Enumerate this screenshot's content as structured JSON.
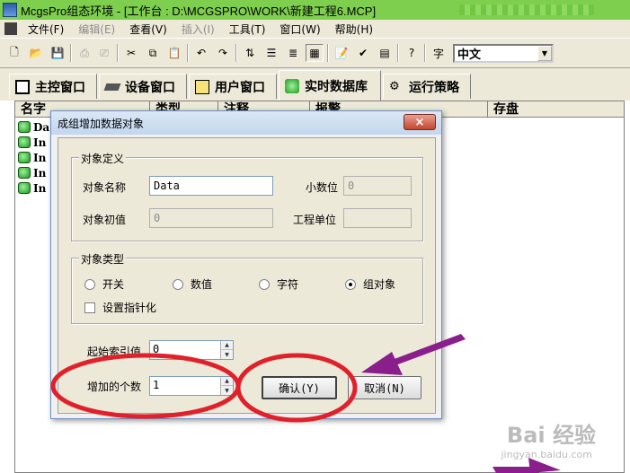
{
  "window": {
    "title": "McgsPro组态环境 - [工作台 : D:\\MCGSPRO\\WORK\\新建工程6.MCP]"
  },
  "menu": [
    {
      "label": "文件(F)",
      "enabled": true
    },
    {
      "label": "编辑(E)",
      "enabled": false
    },
    {
      "label": "查看(V)",
      "enabled": true
    },
    {
      "label": "插入(I)",
      "enabled": false
    },
    {
      "label": "工具(T)",
      "enabled": true
    },
    {
      "label": "窗口(W)",
      "enabled": true
    },
    {
      "label": "帮助(H)",
      "enabled": true
    }
  ],
  "toolbar": {
    "language": "中文"
  },
  "tabs": [
    {
      "label": "主控窗口",
      "icon": "main-window-icon"
    },
    {
      "label": "设备窗口",
      "icon": "device-window-icon"
    },
    {
      "label": "用户窗口",
      "icon": "user-window-icon"
    },
    {
      "label": "实时数据库",
      "icon": "database-icon",
      "active": true
    },
    {
      "label": "运行策略",
      "icon": "strategy-icon"
    }
  ],
  "list": {
    "columns": [
      "名字",
      "类型",
      "注释",
      "报警",
      "存盘"
    ],
    "rows": [
      "Da",
      "In",
      "In",
      "In",
      "In"
    ]
  },
  "dialog": {
    "title": "成组增加数据对象",
    "close_label": "×",
    "object_def": {
      "group_label": "对象定义",
      "name_label": "对象名称",
      "name_value": "Data",
      "decimal_label": "小数位",
      "decimal_value": "0",
      "init_label": "对象初值",
      "init_value": "0",
      "unit_label": "工程单位",
      "unit_value": ""
    },
    "object_type": {
      "group_label": "对象类型",
      "options": [
        {
          "label": "开关",
          "selected": false
        },
        {
          "label": "数值",
          "selected": false
        },
        {
          "label": "字符",
          "selected": false
        },
        {
          "label": "组对象",
          "selected": true
        }
      ],
      "pointer_label": "设置指针化"
    },
    "start_index_label": "起始索引值",
    "start_index_value": "0",
    "count_label": "增加的个数",
    "count_value": "1",
    "ok_label": "确认(Y)",
    "cancel_label": "取消(N)"
  },
  "annotation_colors": {
    "circle": "#e0202a",
    "arrow": "#8a1f8c"
  },
  "watermark": {
    "main": "Bai 经验",
    "sub": "jingyan.baidu.com"
  }
}
